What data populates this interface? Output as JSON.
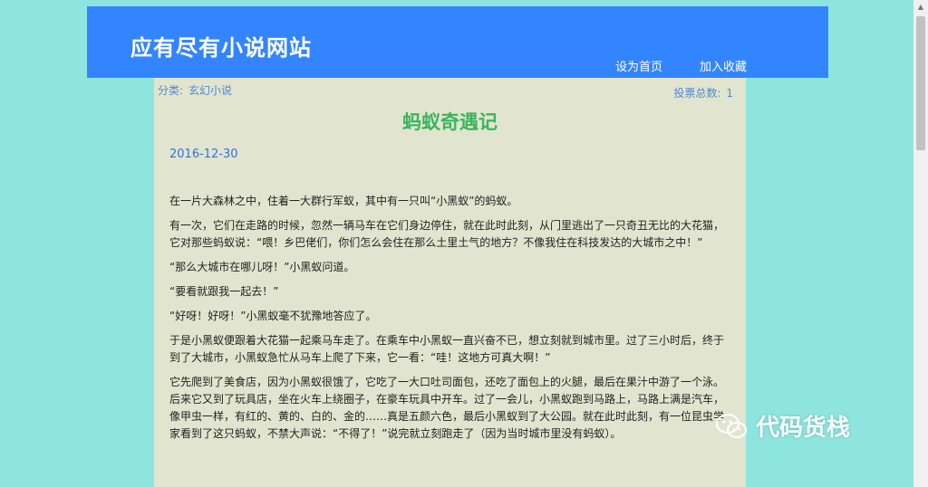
{
  "header": {
    "site_title": "应有尽有小说网站",
    "nav": [
      "设为首页",
      "加入收藏"
    ]
  },
  "meta": {
    "category_label": "分类:",
    "category_value": "玄幻小说",
    "votes_label": "投票总数:",
    "votes_value": "1"
  },
  "story": {
    "title": "蚂蚁奇遇记",
    "date": "2016-12-30",
    "paragraphs": [
      "在一片大森林之中，住着一大群行军蚁，其中有一只叫“小黑蚁”的蚂蚁。",
      "有一次，它们在走路的时候，忽然一辆马车在它们身边停住，就在此时此刻，从门里逃出了一只奇丑无比的大花猫，它对那些蚂蚁说：“喂！乡巴佬们，你们怎么会住在那么土里土气的地方？不像我住在科技发达的大城市之中！”",
      "“那么大城市在哪儿呀！”小黑蚁问道。",
      "“要看就跟我一起去！”",
      "“好呀！好呀！”小黑蚁毫不犹豫地答应了。",
      "于是小黑蚁便跟着大花猫一起乘马车走了。在乘车中小黑蚁一直兴奋不已，想立刻就到城市里。过了三小时后，终于到了大城市，小黑蚁急忙从马车上爬了下来，它一看：“哇！这地方可真大啊！”",
      "它先爬到了美食店，因为小黑蚁很饿了，它吃了一大口吐司面包，还吃了面包上的火腿，最后在果汁中游了一个泳。后来它又到了玩具店，坐在火车上绕圈子，在豪车玩具中开车。过了一会儿，小黑蚁跑到马路上，马路上满是汽车，像甲虫一样，有红的、黄的、白的、金的……真是五颜六色，最后小黑蚁到了大公园。就在此时此刻，有一位昆虫学家看到了这只蚂蚁，不禁大声说：“不得了！”说完就立刻跑走了（因为当时城市里没有蚂蚁）。"
    ]
  },
  "watermark": {
    "text": "代码货栈",
    "icon": "wechat-icon"
  },
  "colors": {
    "page_bg": "#8ee5e0",
    "header_bg": "#3385ff",
    "content_bg": "#e1e5cf",
    "title_green": "#3bb55c",
    "link_blue": "#4f88d6"
  }
}
